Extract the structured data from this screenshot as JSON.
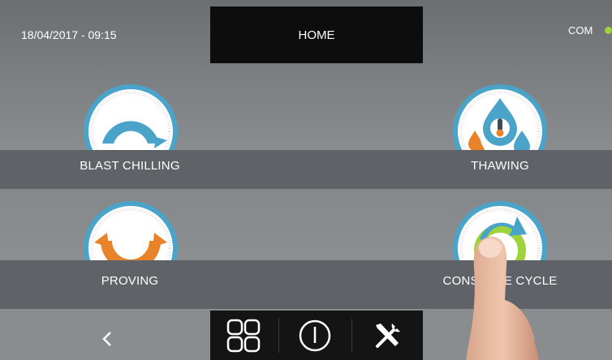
{
  "header": {
    "datetime": "18/04/2017 - 09:15",
    "title": "HOME",
    "status": "COM",
    "status_color": "#9fd33a"
  },
  "tiles": [
    {
      "label": "BLAST CHILLING",
      "icon": "blast-chilling-arrow-icon",
      "color": "#4aa3c8"
    },
    {
      "label": "THAWING",
      "icon": "thawing-drops-icon",
      "color": "#4aa3c8"
    },
    {
      "label": "PROVING",
      "icon": "proving-arrow-icon",
      "color": "#e8832a"
    },
    {
      "label": "CONSERVE CYCLE",
      "icon": "cycle-icon",
      "color": "#4aa3c8"
    }
  ],
  "nav": {
    "back_icon": "chevron-left-icon",
    "items": [
      {
        "icon": "grid-icon"
      },
      {
        "icon": "power-icon"
      },
      {
        "icon": "tools-icon"
      }
    ],
    "right_icon": "refresh-icon"
  },
  "colors": {
    "accent_blue": "#4aa3c8",
    "accent_orange": "#e8832a",
    "ring": "#ffffff"
  }
}
